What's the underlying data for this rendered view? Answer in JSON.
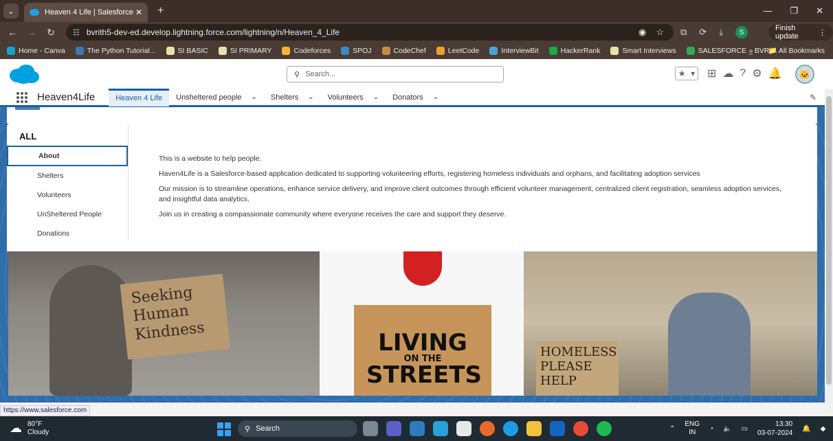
{
  "browser": {
    "tab_title": "Heaven 4 Life | Salesforce",
    "url": "bvrith5-dev-ed.develop.lightning.force.com/lightning/n/Heaven_4_Life",
    "profile_initial": "S",
    "finish_update": "Finish update",
    "bookmarks": [
      {
        "label": "Home - Canva",
        "color": "#1aa1c8"
      },
      {
        "label": "The Python Tutorial...",
        "color": "#3b78b5"
      },
      {
        "label": "SI BASIC",
        "color": "#e8e0b0"
      },
      {
        "label": "SI PRIMARY",
        "color": "#e8e0b0"
      },
      {
        "label": "Codeforces",
        "color": "#f3b23a"
      },
      {
        "label": "SPOJ",
        "color": "#3f86c5"
      },
      {
        "label": "CodeChef",
        "color": "#c48a4a"
      },
      {
        "label": "LeetCode",
        "color": "#f0a030"
      },
      {
        "label": "InterviewBit",
        "color": "#4aa3d8"
      },
      {
        "label": "HackerRank",
        "color": "#1ba94c"
      },
      {
        "label": "Smart Interviews",
        "color": "#e8e0b0"
      },
      {
        "label": "SALESFORCE _ BVRI...",
        "color": "#34a853"
      }
    ],
    "all_bookmarks": "All Bookmarks"
  },
  "salesforce": {
    "search_placeholder": "Search...",
    "app_name": "Heaven4Life",
    "nav": [
      {
        "label": "Heaven 4 Life",
        "active": true
      },
      {
        "label": "Unsheltered people"
      },
      {
        "label": "Shelters"
      },
      {
        "label": "Volunteers"
      },
      {
        "label": "Donators"
      }
    ],
    "accent": "#1b5fa6"
  },
  "page": {
    "sidebar_title": "ALL",
    "sidebar_items": [
      "About",
      "Shelters",
      "Volunteers",
      "UnSheltered People",
      "Donations"
    ],
    "paragraphs": [
      "This is a website to help people.",
      "Haven4Life is a Salesforce-based application dedicated to supporting volunteering efforts, registering homeless individuals and orphans, and facilitating adoption services",
      "Our mission is to streamline operations, enhance service delivery, and improve client outcomes through efficient volunteer management, centralized client registration, seamless adoption services, and insightful data analytics.",
      "Join us in creating a compassionate community where everyone receives the care and support they deserve."
    ],
    "banner": {
      "img1_sign": "Seeking Human Kindness",
      "img2_line1": "LIVING",
      "img2_line2": "ON THE",
      "img2_line3": "STREETS",
      "img3_sign": "HOMELESS PLEASE HELP"
    }
  },
  "status_url": "https://www.salesforce.com",
  "taskbar": {
    "temp": "80°F",
    "weather": "Cloudy",
    "search": "Search",
    "lang1": "ENG",
    "lang2": "IN",
    "time": "13:30",
    "date": "03-07-2024"
  }
}
